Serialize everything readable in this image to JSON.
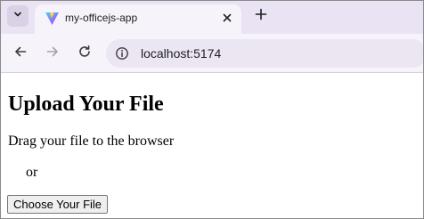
{
  "browser": {
    "tab": {
      "title": "my-officejs-app",
      "favicon": "vite-logo-icon",
      "close_icon": "close-icon"
    },
    "tab_list_icon": "chevron-down-icon",
    "new_tab_icon": "plus-icon",
    "toolbar": {
      "back_icon": "arrow-left-icon",
      "forward_icon": "arrow-right-icon",
      "reload_icon": "reload-icon",
      "site_info_icon": "info-icon",
      "url": "localhost:5174"
    },
    "colors": {
      "tabstrip_bg": "#e9e3f3",
      "toolbar_bg": "#f7f3fb",
      "omnibox_bg": "#ece6f3"
    }
  },
  "page": {
    "title": "Upload Your File",
    "drag_text": "Drag your file to the browser",
    "or_text": "or",
    "choose_button_label": "Choose Your File"
  }
}
